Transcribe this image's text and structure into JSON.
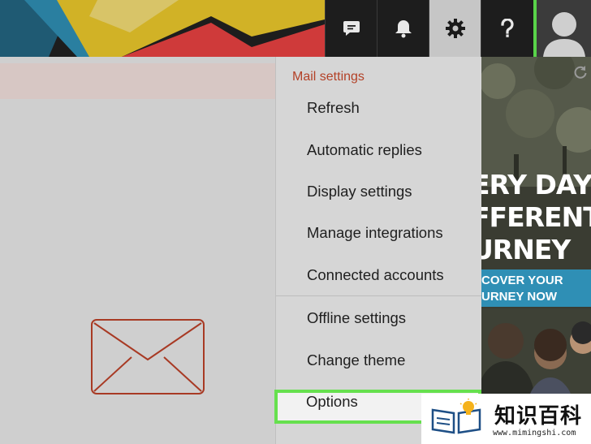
{
  "menu": {
    "header": "Mail settings",
    "items": [
      "Refresh",
      "Automatic replies",
      "Display settings",
      "Manage integrations",
      "Connected accounts",
      "Offline settings",
      "Change theme",
      "Options"
    ]
  },
  "header_icons": [
    "chat-icon",
    "bell-icon",
    "gear-icon",
    "help-icon",
    "avatar"
  ],
  "ad": {
    "lines": [
      "ERY DAY A",
      "FFERENT",
      "URNEY"
    ],
    "button_lines": [
      "COVER YOUR",
      "URNEY NOW"
    ]
  },
  "watermark": {
    "title": "知识百科",
    "url": "www.mimingshi.com"
  },
  "colors": {
    "menu_header": "#b34127",
    "highlight": "#66e04e",
    "ad_button": "#2f8fb5",
    "envelope": "#a83a24"
  }
}
